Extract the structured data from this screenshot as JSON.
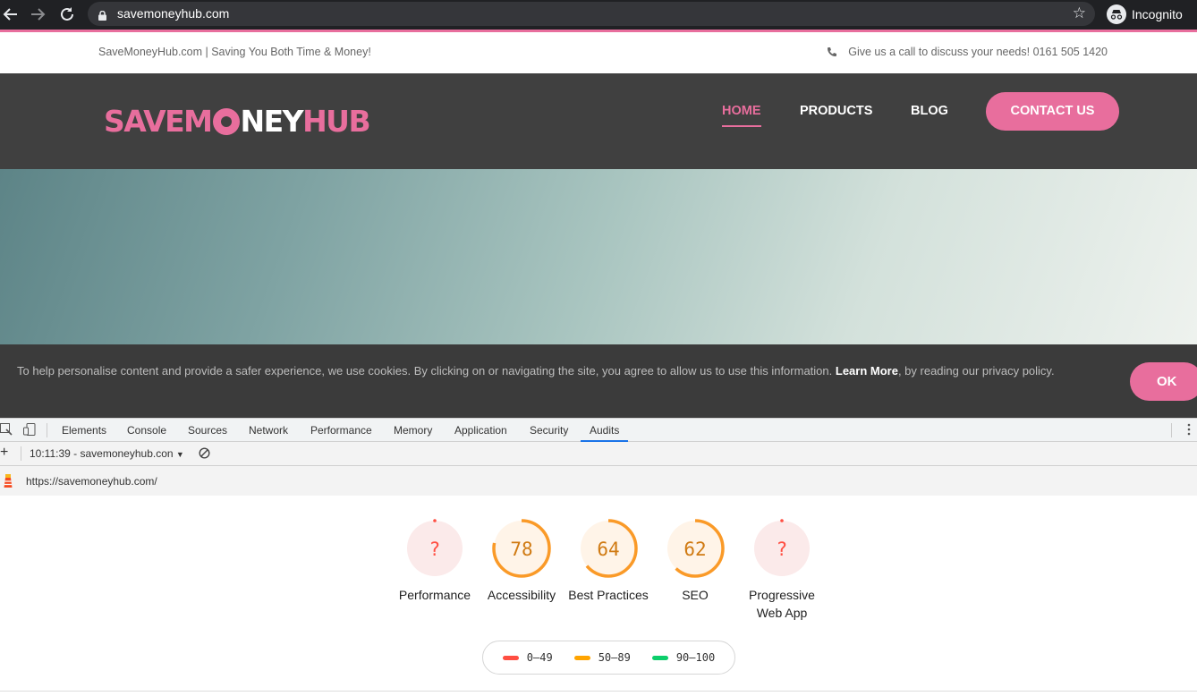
{
  "browser": {
    "url": "savemoneyhub.com",
    "profile_label": "Incognito",
    "icons": [
      "back-arrow-icon",
      "forward-arrow-icon",
      "reload-icon",
      "lock-icon",
      "star-icon",
      "incognito-icon"
    ]
  },
  "site": {
    "tagline": "SaveMoneyHub.com | Saving You Both Time & Money!",
    "phone_text": "Give us a call to discuss your needs! 0161 505 1420",
    "logo": {
      "part1": "SAVEM",
      "part2": "NEY",
      "part3": "HUB"
    },
    "nav": [
      "HOME",
      "PRODUCTS",
      "BLOG"
    ],
    "contact_label": "CONTACT US",
    "colors": {
      "brand_pink": "#e86e9d",
      "header_bg": "#404040"
    }
  },
  "cookie": {
    "text_before": "To help personalise content and provide a safer experience, we use cookies. By clicking on or navigating the site, you agree to allow us to use this information.",
    "link": "Learn More",
    "text_after": ", by reading our privacy policy.",
    "ok_label": "OK"
  },
  "devtools": {
    "tabs": [
      "Elements",
      "Console",
      "Sources",
      "Network",
      "Performance",
      "Memory",
      "Application",
      "Security",
      "Audits"
    ],
    "active_tab": "Audits",
    "report_select": "10:11:39 - savemoneyhub.con",
    "audited_url": "https://savemoneyhub.com/"
  },
  "audits": {
    "gauges": [
      {
        "label": "Performance",
        "value": "?",
        "score": 0
      },
      {
        "label": "Accessibility",
        "value": "78",
        "score": 78
      },
      {
        "label": "Best Practices",
        "value": "64",
        "score": 64
      },
      {
        "label": "SEO",
        "value": "62",
        "score": 62
      },
      {
        "label": "Progressive Web App",
        "value": "?",
        "score": 0
      }
    ],
    "legend": [
      {
        "range": "0–49",
        "color": "#ff4e42"
      },
      {
        "range": "50–89",
        "color": "#ffa400"
      },
      {
        "range": "90–100",
        "color": "#0cce6b"
      }
    ],
    "colors": {
      "fail": "#ff4e42",
      "average": "#fa9a28",
      "pass": "#0cce6b"
    }
  }
}
